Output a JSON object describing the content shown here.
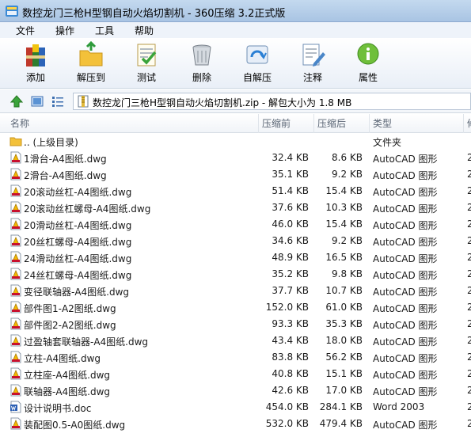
{
  "window": {
    "title": "数控龙门三枪H型钢自动火焰切割机 - 360压缩 3.2正式版"
  },
  "menu": [
    "文件",
    "操作",
    "工具",
    "帮助"
  ],
  "toolbar": [
    {
      "label": "添加",
      "icon": "add-archive-icon"
    },
    {
      "label": "解压到",
      "icon": "extract-to-icon"
    },
    {
      "label": "测试",
      "icon": "test-icon"
    },
    {
      "label": "删除",
      "icon": "delete-icon"
    },
    {
      "label": "自解压",
      "icon": "self-extract-icon"
    },
    {
      "label": "注释",
      "icon": "comment-icon"
    },
    {
      "label": "属性",
      "icon": "info-icon"
    }
  ],
  "address": {
    "path": "数控龙门三枪H型钢自动火焰切割机.zip - 解包大小为 1.8 MB"
  },
  "columns": [
    "名称",
    "压缩前",
    "压缩后",
    "类型",
    "修"
  ],
  "files": [
    {
      "name": ".. (上级目录)",
      "size": "",
      "packed": "",
      "type": "文件夹",
      "kind": "folder",
      "extra": ""
    },
    {
      "name": "1滑台-A4图纸.dwg",
      "size": "32.4 KB",
      "packed": "8.6 KB",
      "type": "AutoCAD 图形",
      "kind": "dwg",
      "extra": "2"
    },
    {
      "name": "2滑台-A4图纸.dwg",
      "size": "35.1 KB",
      "packed": "9.2 KB",
      "type": "AutoCAD 图形",
      "kind": "dwg",
      "extra": "2"
    },
    {
      "name": "20滚动丝杠-A4图纸.dwg",
      "size": "51.4 KB",
      "packed": "15.4 KB",
      "type": "AutoCAD 图形",
      "kind": "dwg",
      "extra": "2"
    },
    {
      "name": "20滚动丝杠螺母-A4图纸.dwg",
      "size": "37.6 KB",
      "packed": "10.3 KB",
      "type": "AutoCAD 图形",
      "kind": "dwg",
      "extra": "2"
    },
    {
      "name": "20滑动丝杠-A4图纸.dwg",
      "size": "46.0 KB",
      "packed": "15.4 KB",
      "type": "AutoCAD 图形",
      "kind": "dwg",
      "extra": "2"
    },
    {
      "name": "20丝杠螺母-A4图纸.dwg",
      "size": "34.6 KB",
      "packed": "9.2 KB",
      "type": "AutoCAD 图形",
      "kind": "dwg",
      "extra": "2"
    },
    {
      "name": "24滑动丝杠-A4图纸.dwg",
      "size": "48.9 KB",
      "packed": "16.5 KB",
      "type": "AutoCAD 图形",
      "kind": "dwg",
      "extra": "2"
    },
    {
      "name": "24丝杠螺母-A4图纸.dwg",
      "size": "35.2 KB",
      "packed": "9.8 KB",
      "type": "AutoCAD 图形",
      "kind": "dwg",
      "extra": "2"
    },
    {
      "name": "变径联轴器-A4图纸.dwg",
      "size": "37.7 KB",
      "packed": "10.7 KB",
      "type": "AutoCAD 图形",
      "kind": "dwg",
      "extra": "2"
    },
    {
      "name": "部件图1-A2图纸.dwg",
      "size": "152.0 KB",
      "packed": "61.0 KB",
      "type": "AutoCAD 图形",
      "kind": "dwg",
      "extra": "2"
    },
    {
      "name": "部件图2-A2图纸.dwg",
      "size": "93.3 KB",
      "packed": "35.3 KB",
      "type": "AutoCAD 图形",
      "kind": "dwg",
      "extra": "2"
    },
    {
      "name": "过盈轴套联轴器-A4图纸.dwg",
      "size": "43.4 KB",
      "packed": "18.0 KB",
      "type": "AutoCAD 图形",
      "kind": "dwg",
      "extra": "2"
    },
    {
      "name": "立柱-A4图纸.dwg",
      "size": "83.8 KB",
      "packed": "56.2 KB",
      "type": "AutoCAD 图形",
      "kind": "dwg",
      "extra": "2"
    },
    {
      "name": "立柱座-A4图纸.dwg",
      "size": "40.8 KB",
      "packed": "15.1 KB",
      "type": "AutoCAD 图形",
      "kind": "dwg",
      "extra": "2"
    },
    {
      "name": "联轴器-A4图纸.dwg",
      "size": "42.6 KB",
      "packed": "17.0 KB",
      "type": "AutoCAD 图形",
      "kind": "dwg",
      "extra": "2"
    },
    {
      "name": "设计说明书.doc",
      "size": "454.0 KB",
      "packed": "284.1 KB",
      "type": "Word 2003",
      "kind": "doc",
      "extra": "2"
    },
    {
      "name": "装配图0.5-A0图纸.dwg",
      "size": "532.0 KB",
      "packed": "479.4 KB",
      "type": "AutoCAD 图形",
      "kind": "dwg",
      "extra": "2"
    }
  ]
}
